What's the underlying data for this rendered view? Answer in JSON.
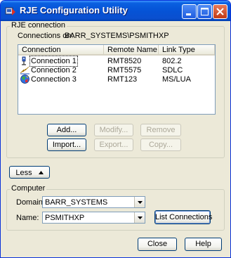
{
  "window": {
    "title": "RJE Configuration Utility",
    "icon": "rje-app-icon",
    "controls": [
      "minimize-icon",
      "maximize-icon",
      "close-icon"
    ]
  },
  "rje_group": {
    "label": "RJE connection",
    "connections_on_label": "Connections on:",
    "connections_on_value": "BARR_SYSTEMS\\PSMITHXP"
  },
  "list": {
    "columns": [
      "Connection",
      "Remote Name",
      "Link Type"
    ],
    "rows": [
      {
        "icon": "network-card-icon",
        "connection": "Connection 1",
        "remote": "RMT8520",
        "link": "802.2"
      },
      {
        "icon": "lightning-link-icon",
        "connection": "Connection 2",
        "remote": "RMT5575",
        "link": "SDLC"
      },
      {
        "icon": "globe-icon",
        "connection": "Connection 3",
        "remote": "RMT123",
        "link": "MS/LUA"
      }
    ]
  },
  "buttons": {
    "add": "Add...",
    "modify": "Modify...",
    "remove": "Remove",
    "import": "Import...",
    "export": "Export...",
    "copy": "Copy...",
    "less": "Less",
    "list_connections": "List Connections",
    "close": "Close",
    "help": "Help"
  },
  "computer_group": {
    "label": "Computer",
    "domain_label": "Domain:",
    "domain_value": "BARR_SYSTEMS",
    "name_label": "Name:",
    "name_value": "PSMITHXP"
  }
}
